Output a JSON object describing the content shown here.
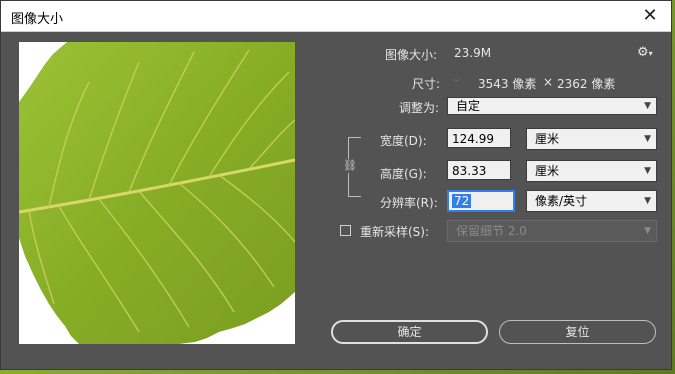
{
  "window": {
    "title": "图像大小",
    "close_label": "✕"
  },
  "image_size": {
    "label": "图像大小:",
    "value": "23.9M"
  },
  "dimensions": {
    "label": "尺寸:",
    "width": "3543 像素",
    "times": "×",
    "height": "2362 像素"
  },
  "fit_to": {
    "label": "调整为:",
    "value": "自定"
  },
  "width": {
    "label": "宽度(D):",
    "value": "124.99",
    "unit": "厘米"
  },
  "height": {
    "label": "高度(G):",
    "value": "83.33",
    "unit": "厘米"
  },
  "resolution": {
    "label": "分辨率(R):",
    "value": "72",
    "unit": "像素/英寸"
  },
  "resample": {
    "label": "重新采样(S):",
    "checked": false,
    "value": "保留细节 2.0"
  },
  "buttons": {
    "ok": "确定",
    "reset": "复位"
  },
  "icons": {
    "gear": "gear-icon",
    "link": "chain-link-icon",
    "close": "close-icon"
  },
  "colors": {
    "dialog_bg": "#535353",
    "accent": "#2f80ed",
    "leaf": "#8db52a"
  }
}
